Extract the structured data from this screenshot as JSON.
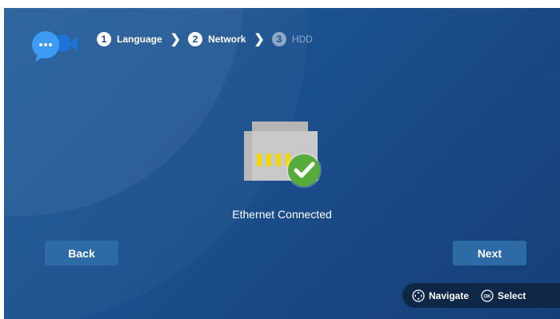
{
  "header": {
    "logo_icon": "chat-camera-icon",
    "steps": [
      {
        "number": "1",
        "label": "Language",
        "state": "done"
      },
      {
        "number": "2",
        "label": "Network",
        "state": "current"
      },
      {
        "number": "3",
        "label": "HDD",
        "state": "pending"
      }
    ],
    "separator_icon": "chevron-right-icon"
  },
  "main": {
    "status_icon": "ethernet-port-check-icon",
    "status_text": "Ethernet Connected"
  },
  "buttons": {
    "back_label": "Back",
    "next_label": "Next"
  },
  "hints": {
    "navigate_icon": "dpad-icon",
    "navigate_label": "Navigate",
    "select_icon": "ok-button-icon",
    "select_label": "Select"
  },
  "colors": {
    "background": "#1a4f8d",
    "button": "#2d6aa6",
    "check": "#56ab3a",
    "port_contacts": "#f5d800",
    "hint_bar": "#0f2747"
  }
}
